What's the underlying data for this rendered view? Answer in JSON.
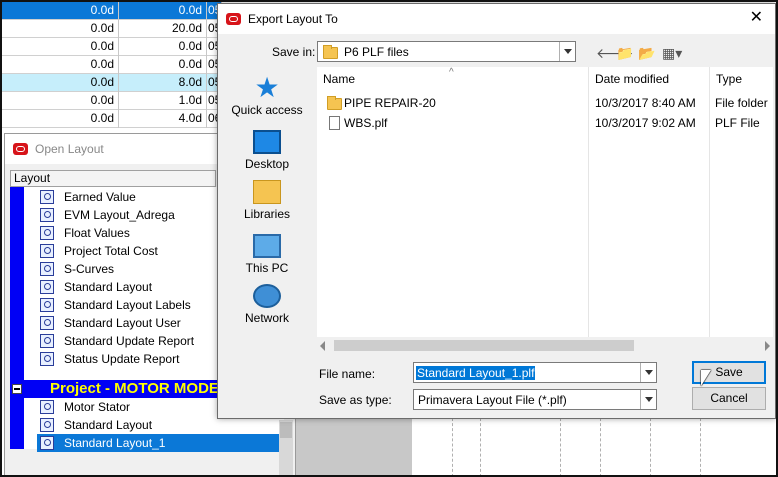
{
  "background_grid": {
    "rows": [
      {
        "c1": "0.0d",
        "c2": "0.0d",
        "c3": "05",
        "state": "selected"
      },
      {
        "c1": "0.0d",
        "c2": "20.0d",
        "c3": "05",
        "state": "normal"
      },
      {
        "c1": "0.0d",
        "c2": "0.0d",
        "c3": "05",
        "state": "normal"
      },
      {
        "c1": "0.0d",
        "c2": "0.0d",
        "c3": "05",
        "state": "normal"
      },
      {
        "c1": "0.0d",
        "c2": "8.0d",
        "c3": "05",
        "state": "highlight"
      },
      {
        "c1": "0.0d",
        "c2": "1.0d",
        "c3": "05",
        "state": "normal"
      },
      {
        "c1": "0.0d",
        "c2": "4.0d",
        "c3": "06",
        "state": "normal"
      }
    ]
  },
  "open_layout": {
    "title": "Open Layout",
    "column_header": "Layout",
    "items": [
      "Earned Value",
      "EVM Layout_Adrega",
      "Float Values",
      "Project Total Cost",
      "S-Curves",
      "Standard Layout",
      "Standard Layout Labels",
      "Standard Layout User",
      "Standard Update Report",
      "Status Update Report"
    ],
    "project_group": "Project - MOTOR MODE",
    "project_items": [
      "Motor Stator",
      "Standard Layout",
      "Standard Layout_1"
    ],
    "selected_item": "Standard Layout_1"
  },
  "export_dialog": {
    "title": "Export Layout To",
    "save_in_label": "Save in:",
    "save_in_value": "P6 PLF files",
    "places": [
      "Quick access",
      "Desktop",
      "Libraries",
      "This PC",
      "Network"
    ],
    "columns": {
      "name": "Name",
      "date": "Date modified",
      "type": "Type"
    },
    "files": [
      {
        "name": "PIPE REPAIR-20",
        "date": "10/3/2017 8:40 AM",
        "type": "File folder",
        "kind": "folder"
      },
      {
        "name": "WBS.plf",
        "date": "10/3/2017 9:02 AM",
        "type": "PLF File",
        "kind": "file"
      }
    ],
    "file_name_label": "File name:",
    "file_name_value": "Standard Layout_1.plf",
    "save_type_label": "Save as type:",
    "save_type_value": "Primavera Layout File (*.plf)",
    "save_button": "Save",
    "cancel_button": "Cancel",
    "close_glyph": "✕"
  },
  "colors": {
    "selection": "#0078d7",
    "project_band": "#0000f5",
    "project_text": "#ffff00",
    "oracle_red": "#d7141a"
  }
}
